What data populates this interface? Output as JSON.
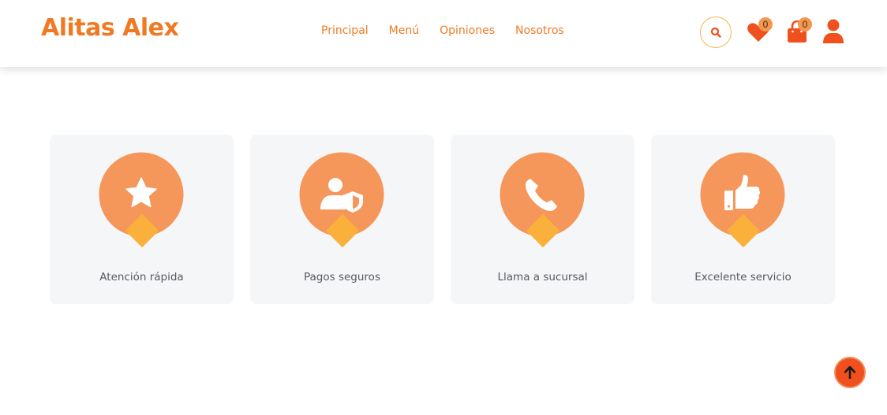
{
  "brand": {
    "name": "Alitas Alex"
  },
  "nav": [
    {
      "label": "Principal"
    },
    {
      "label": "Menú"
    },
    {
      "label": "Opiniones"
    },
    {
      "label": "Nosotros"
    }
  ],
  "header_actions": {
    "search_icon": "search-icon",
    "wishlist": {
      "icon": "heart-icon",
      "count": "0"
    },
    "cart": {
      "icon": "shopping-bag-icon",
      "count": "0"
    },
    "account_icon": "user-icon"
  },
  "features": [
    {
      "label": "Atención rápida",
      "icon": "star-icon"
    },
    {
      "label": "Pagos seguros",
      "icon": "user-shield-icon"
    },
    {
      "label": "Llama a sucursal",
      "icon": "phone-icon"
    },
    {
      "label": "Excelente servicio",
      "icon": "thumbs-up-icon"
    }
  ],
  "colors": {
    "brand_orange": "#f07a24",
    "circle": "#f5965a",
    "diamond": "#fbb03b",
    "accent_red": "#f04f1e",
    "card_bg": "#f5f6f8"
  },
  "scroll_top": {
    "icon": "arrow-up-icon"
  }
}
